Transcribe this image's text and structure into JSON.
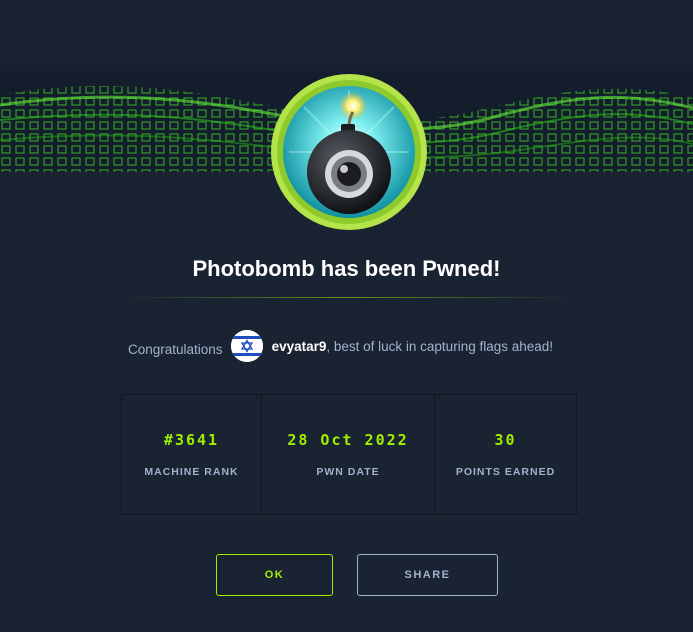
{
  "dialog": {
    "title": "Photobomb has been Pwned!",
    "congrats_lead": "Congratulations",
    "username": "evyatar9",
    "congrats_tail": ", best of luck in capturing flags ahead!"
  },
  "stats": [
    {
      "value": "#3641",
      "label": "MACHINE RANK"
    },
    {
      "value": "28 Oct 2022",
      "label": "PWN DATE"
    },
    {
      "value": "30",
      "label": "POINTS EARNED"
    }
  ],
  "buttons": {
    "ok": "OK",
    "share": "SHARE"
  },
  "icons": {
    "badge": "bomb-camera-icon",
    "avatar": "israel-flag-avatar"
  },
  "colors": {
    "accent_green": "#9fef00",
    "background": "#1a2332",
    "text_muted": "#a4b1cd",
    "text_white": "#ffffff"
  }
}
